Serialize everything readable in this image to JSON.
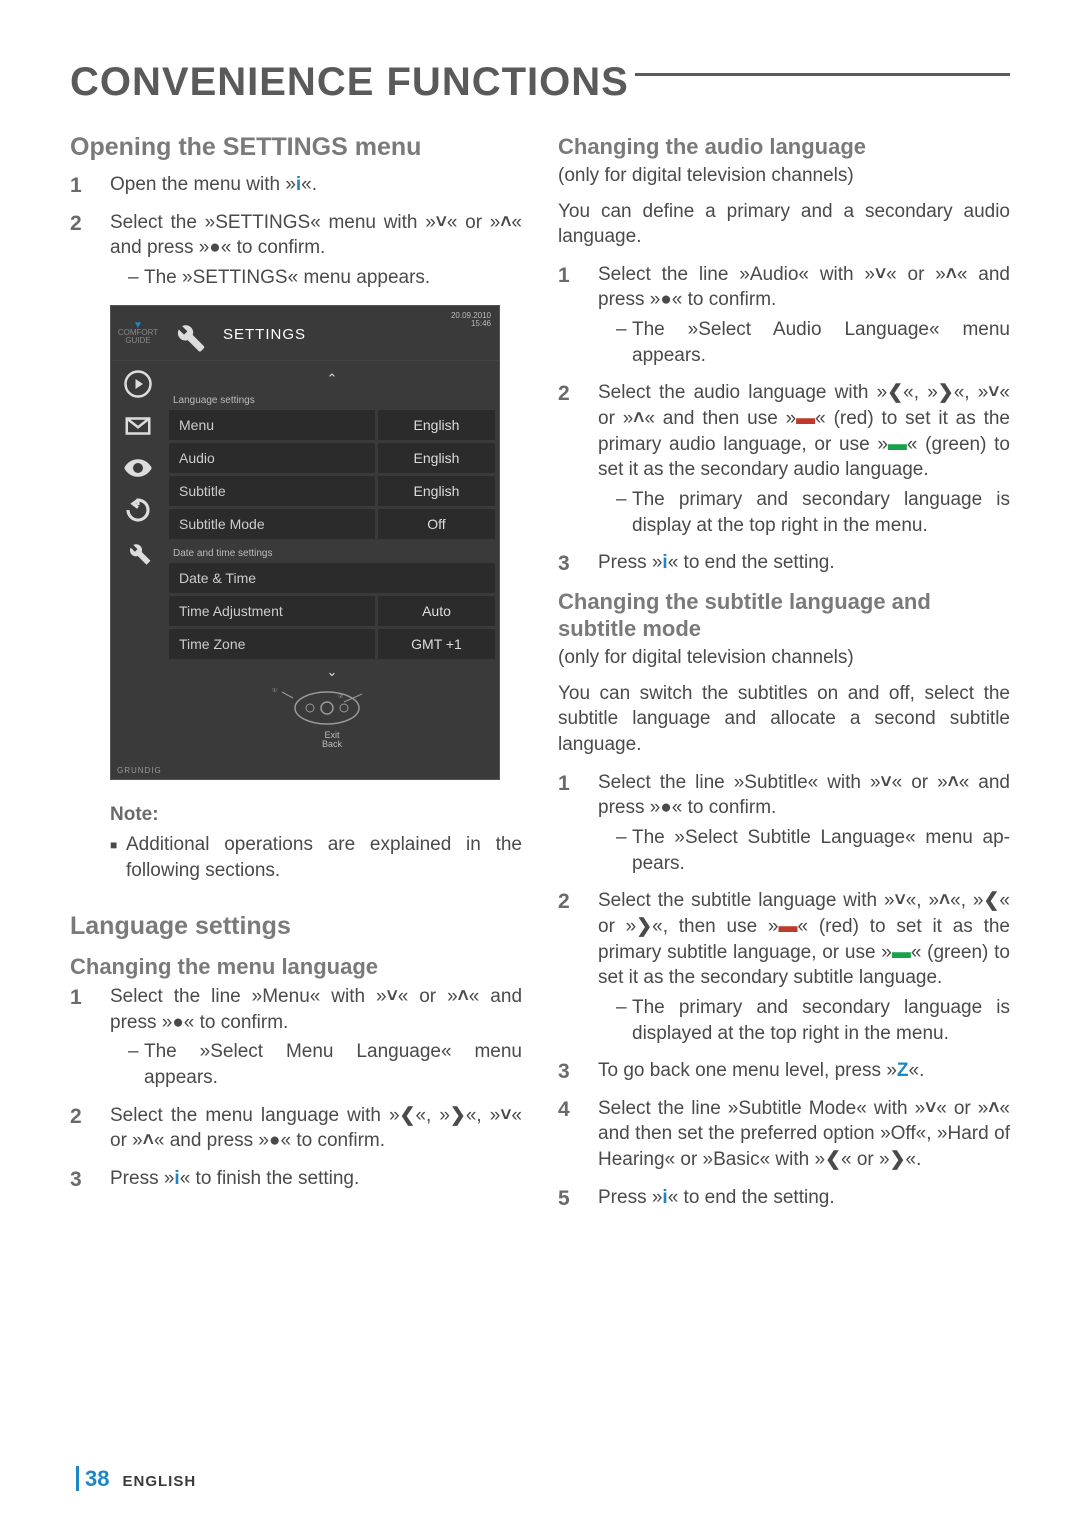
{
  "pageTitle": "CONVENIENCE FUNCTIONS",
  "footer": {
    "page": "38",
    "lang": "ENGLISH"
  },
  "glyphs": {
    "info": "i",
    "down": "˅",
    "up": "˄",
    "left": "❮",
    "right": "❯",
    "dot": "●",
    "bar": "▬",
    "back": "Z"
  },
  "leftCol": {
    "h2": "Opening the SETTINGS menu",
    "steps": [
      {
        "pre": "Open the menu with »",
        "g1": "info",
        "post": "«."
      },
      {
        "pre": "Select the »SETTINGS« menu with »",
        "g1": "down",
        "mid1": "« or »",
        "g2": "up",
        "mid2": "« and press »",
        "g3": "dot",
        "post": "« to confirm.",
        "dash": "The »SETTINGS« menu appears."
      }
    ],
    "noteHd": "Note:",
    "noteBody": "Additional operations are explained in the following sections.",
    "lang_h2": "Language settings",
    "menu_h3": "Changing the menu language",
    "menuSteps": [
      {
        "pre": "Select the line »Menu« with »",
        "g1": "down",
        "mid1": "« or »",
        "g2": "up",
        "mid2": "« and press »",
        "g3": "dot",
        "post": "« to confirm.",
        "dash": "The »Select Menu Language« menu appears."
      },
      {
        "pre": "Select the menu language with »",
        "g1": "left",
        "mid1": "«, »",
        "g2": "right",
        "mid2": "«, »",
        "g3": "down",
        "mid3": "« or »",
        "g4": "up",
        "mid4": "« and press »",
        "g5": "dot",
        "post": "« to confirm."
      },
      {
        "pre": "Press »",
        "g1": "info",
        "post": "« to finish the setting."
      }
    ]
  },
  "rightCol": {
    "audio_h3": "Changing the audio language",
    "onlyFor": "(only for digital television channels)",
    "audioLead": "You can define a primary and a secondary audio language.",
    "audioSteps": [
      {
        "pre": "Select the line »Audio« with »",
        "g1": "down",
        "mid1": "« or »",
        "g2": "up",
        "mid2": "« and press »",
        "g3": "dot",
        "post": "« to confirm.",
        "dash": "The »Select Audio Language« menu appears."
      },
      {
        "pre": "Select the audio language with »",
        "g1": "left",
        "mid1": "«, »",
        "g2": "right",
        "mid2": "«, »",
        "g3": "down",
        "mid3": "« or »",
        "g4": "up",
        "mid4": "« and then use »",
        "g5": "bar",
        "g5c": "red",
        "mid5": "« (red) to set it as the primary audio language, or use »",
        "g6": "bar",
        "g6c": "green",
        "post": "« (green) to set it as the secondary audio language.",
        "dash": "The primary and secondary language is display at the top right in the menu."
      },
      {
        "pre": "Press »",
        "g1": "info",
        "post": "« to end the setting."
      }
    ],
    "sub_h3": "Changing the subtitle language and subtitle mode",
    "subLead": "You can switch the subtitles on and off, select the subtitle language and allocate a second subtitle language.",
    "subSteps": [
      {
        "pre": "Select the line »Subtitle« with »",
        "g1": "down",
        "mid1": "« or »",
        "g2": "up",
        "mid2": "« and press »",
        "g3": "dot",
        "post": "« to confirm.",
        "dash": "The »Select Subtitle Language« menu ap­pears."
      },
      {
        "pre": "Select the subtitle language with »",
        "g1": "down",
        "mid1": "«, »",
        "g2": "up",
        "mid2": "«, »",
        "g3": "left",
        "mid3": "« or »",
        "g4": "right",
        "mid4": "«, then use »",
        "g5": "bar",
        "g5c": "red",
        "mid5": "« (red) to set it as the primary subtitle language, or use »",
        "g6": "bar",
        "g6c": "green",
        "post": "« (green) to set it as the secondary sub­title language.",
        "dash": "The primary and secondary language is displayed at the top right in the menu."
      },
      {
        "pre": "To go back one menu level, press »",
        "g1": "back",
        "post": "«."
      },
      {
        "pre": "Select the line »Subtitle Mode« with »",
        "g1": "down",
        "mid1": "« or »",
        "g2": "up",
        "mid2": "« and then set the preferred option »Off«, »Hard of Hearing« or »Basic« with »",
        "g3": "left",
        "mid3": "« or »",
        "g4": "right",
        "post": "«."
      },
      {
        "pre": "Press »",
        "g1": "info",
        "post": "« to end the setting."
      }
    ]
  },
  "tv": {
    "comfort1": "COMFORT",
    "comfort2": "GUIDE",
    "title": "SETTINGS",
    "date": "20.09.2010",
    "time": "15:46",
    "group1": "Language settings",
    "group2": "Date and time settings",
    "rows1": [
      {
        "k": "Menu",
        "v": "English"
      },
      {
        "k": "Audio",
        "v": "English"
      },
      {
        "k": "Subtitle",
        "v": "English"
      },
      {
        "k": "Subtitle Mode",
        "v": "Off"
      }
    ],
    "rows2": [
      {
        "k": "Date & Time",
        "v": ""
      },
      {
        "k": "Time Adjustment",
        "v": "Auto"
      },
      {
        "k": "Time Zone",
        "v": "GMT +1"
      }
    ],
    "navExit": "Exit",
    "navBack": "Back",
    "brand": "GRUNDIG"
  }
}
